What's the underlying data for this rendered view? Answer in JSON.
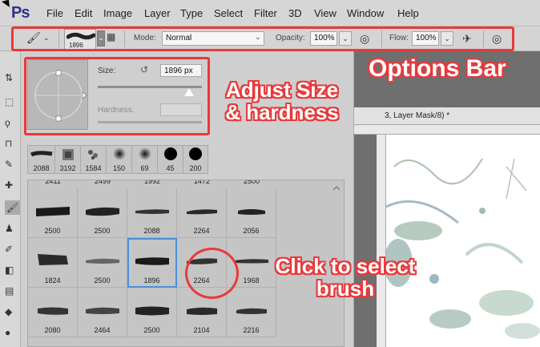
{
  "app": {
    "logo": "Ps"
  },
  "menu": [
    "File",
    "Edit",
    "Image",
    "Layer",
    "Type",
    "Select",
    "Filter",
    "3D",
    "View",
    "Window",
    "Help"
  ],
  "options_bar": {
    "brush_size": "1896",
    "mode_label": "Mode:",
    "mode_value": "Normal",
    "opacity_label": "Opacity:",
    "opacity_value": "100%",
    "flow_label": "Flow:",
    "flow_value": "100%"
  },
  "brush_panel": {
    "size_label": "Size:",
    "size_value": "1896 px",
    "hardness_label": "Hardness:",
    "size_slider_level": 0.88,
    "recent_brushes": [
      "2088",
      "3192",
      "1584",
      "150",
      "69",
      "45",
      "200"
    ],
    "grid_top_row_partial": [
      "2411",
      "2499",
      "1992",
      "1472",
      "2500"
    ],
    "grid_rows": [
      [
        "2500",
        "2500",
        "2088",
        "2264",
        "2056"
      ],
      [
        "1824",
        "2500",
        "1896",
        "2264",
        "1968"
      ],
      [
        "2080",
        "2464",
        "2500",
        "2104",
        "2216"
      ]
    ],
    "selected_brush": "1896"
  },
  "document": {
    "tab_title": "3, Layer Mask/8) *"
  },
  "annotations": {
    "options_bar": "Options Bar",
    "adjust_line1": "Adjust Size",
    "adjust_line2": "& hardness",
    "click_line1": "Click to select",
    "click_line2": "brush"
  },
  "colors": {
    "annotation_red": "#e9393b",
    "selection_blue": "#4a90d9",
    "ps_logo": "#31318a"
  }
}
